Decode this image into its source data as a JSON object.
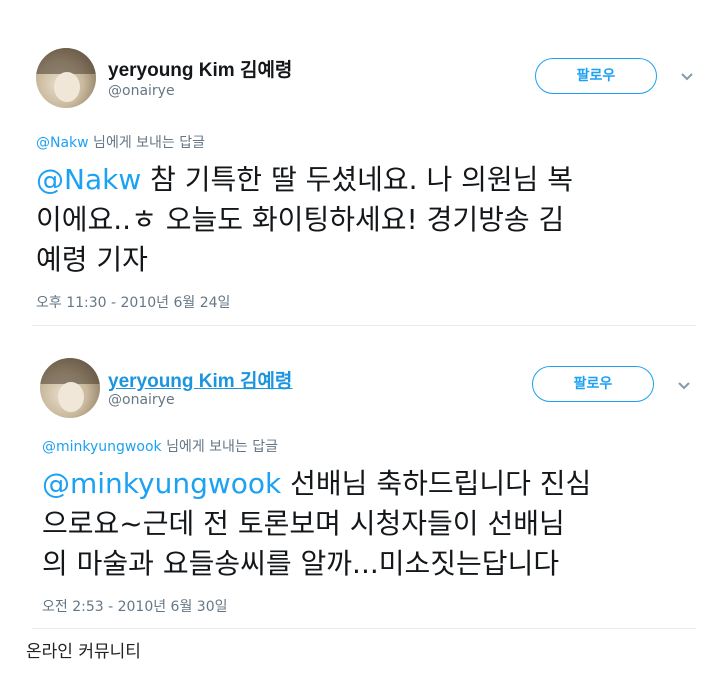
{
  "tweets": [
    {
      "display_name": "yeryoung Kim 김예령",
      "handle": "@onairye",
      "follow_label": "팔로우",
      "reply_to": {
        "mention": "@Nakw",
        "suffix": " 님에게 보내는 답글"
      },
      "body": {
        "mention": "@Nakw",
        "line1_rest": " 참 기특한 딸 두셨네요. 나 의원님 복",
        "line2": "이에요..ㅎ 오늘도 화이팅하세요! 경기방송 김",
        "line3": "예령 기자"
      },
      "timestamp": "오후 11:30 - 2010년 6월 24일"
    },
    {
      "display_name": "yeryoung Kim 김예령",
      "handle": "@onairye",
      "follow_label": "팔로우",
      "reply_to": {
        "mention": "@minkyungwook",
        "suffix": " 님에게 보내는 답글"
      },
      "body": {
        "mention": "@minkyungwook",
        "line1_rest": " 선배님 축하드립니다 진심",
        "line2": "으로요~근데 전 토론보며 시청자들이 선배님",
        "line3": "의 마술과 요들송씨를 알까...미소짓는답니다"
      },
      "timestamp": "오전 2:53 - 2010년 6월 30일"
    }
  ],
  "caption": "온라인 커뮤니티",
  "icons": [
    "avatar",
    "chevron-down-icon"
  ],
  "colors": {
    "accent": "#1da1f2",
    "secondary_text": "#657786",
    "divider": "#e6ecf0"
  }
}
